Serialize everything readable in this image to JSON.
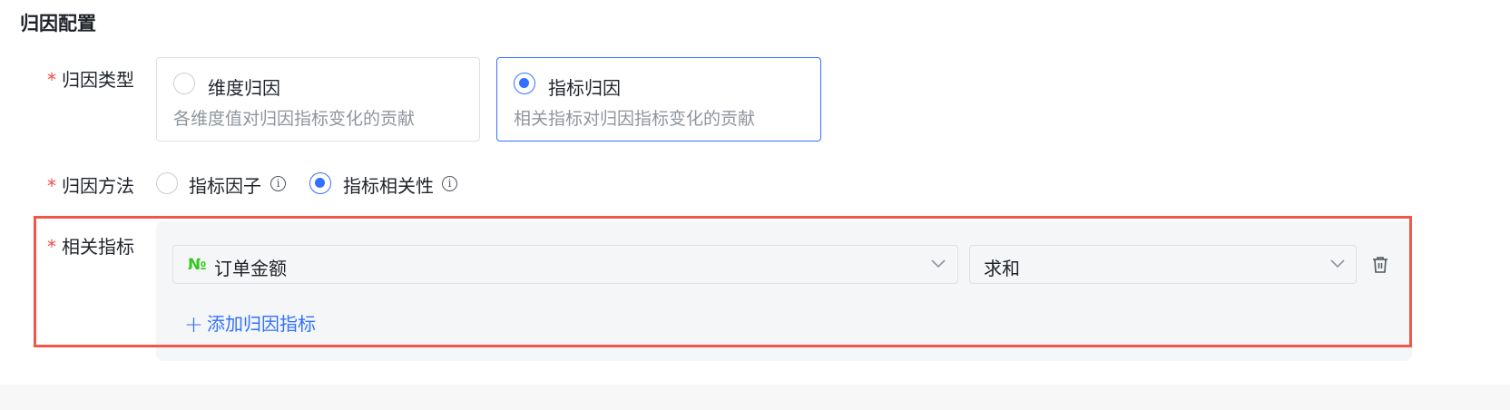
{
  "section": {
    "title": "归因配置"
  },
  "attribution_type": {
    "label": "归因类型",
    "required_mark": "*",
    "options": [
      {
        "title": "维度归因",
        "desc": "各维度值对归因指标变化的贡献",
        "selected": false
      },
      {
        "title": "指标归因",
        "desc": "相关指标对归因指标变化的贡献",
        "selected": true
      }
    ]
  },
  "attribution_method": {
    "label": "归因方法",
    "required_mark": "*",
    "options": [
      {
        "label": "指标因子",
        "selected": false,
        "icon": "info-icon"
      },
      {
        "label": "指标相关性",
        "selected": true,
        "icon": "info-icon"
      }
    ]
  },
  "related_metrics": {
    "label": "相关指标",
    "required_mark": "*",
    "rows": [
      {
        "type_icon": "№",
        "metric": "订单金额",
        "aggregation": "求和"
      }
    ],
    "add_label": "添加归因指标",
    "add_icon": "+"
  },
  "colors": {
    "accent": "#3370ff",
    "required": "#f54a45",
    "number_icon": "#34c724",
    "highlight": "#f0564a"
  }
}
